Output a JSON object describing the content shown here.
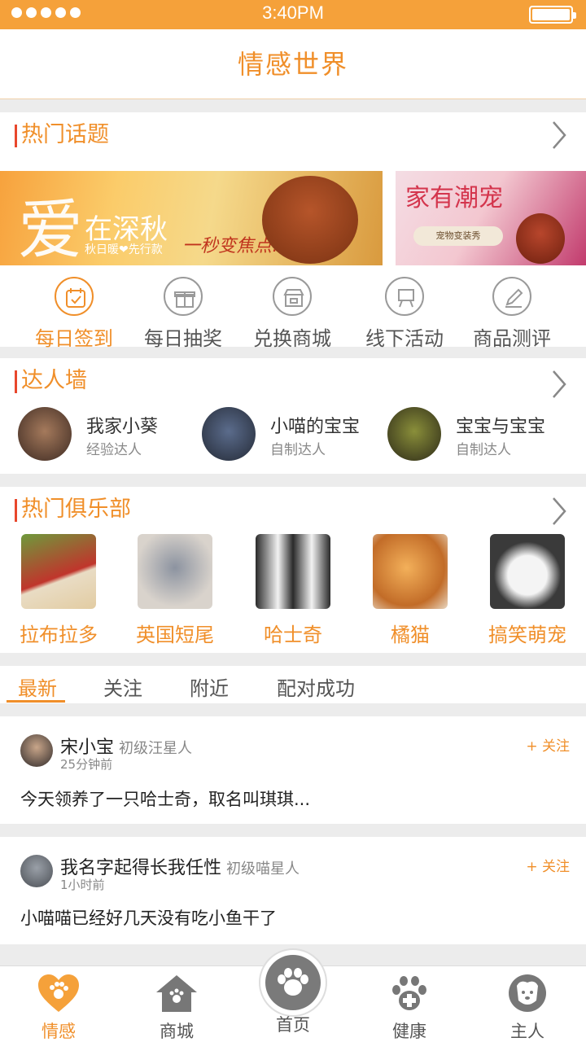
{
  "status_bar": {
    "time": "3:40PM"
  },
  "header": {
    "title": "情感世界"
  },
  "hot_topics": {
    "title": "热门话题",
    "banner1": {
      "big_char": "爱",
      "subtitle": "在深秋",
      "small": "秋日暖❤先行款",
      "slogan": "一秒变焦点!"
    },
    "banner2": {
      "title": "家有潮宠",
      "tag": "宠物变装秀"
    },
    "quick_actions": [
      {
        "label": "每日签到",
        "icon": "calendar-check-icon"
      },
      {
        "label": "每日抽奖",
        "icon": "gift-icon"
      },
      {
        "label": "兑换商城",
        "icon": "store-icon"
      },
      {
        "label": "线下活动",
        "icon": "easel-icon"
      },
      {
        "label": "商品测评",
        "icon": "pencil-icon"
      }
    ]
  },
  "experts": {
    "title": "达人墙",
    "items": [
      {
        "name": "我家小葵",
        "tag": "经验达人"
      },
      {
        "name": "小喵的宝宝",
        "tag": "自制达人"
      },
      {
        "name": "宝宝与宝宝",
        "tag": "自制达人"
      }
    ]
  },
  "clubs": {
    "title": "热门俱乐部",
    "items": [
      {
        "name": "拉布拉多"
      },
      {
        "name": "英国短尾"
      },
      {
        "name": "哈士奇"
      },
      {
        "name": "橘猫"
      },
      {
        "name": "搞笑萌宠"
      }
    ]
  },
  "feed_tabs": [
    "最新",
    "关注",
    "附近",
    "配对成功"
  ],
  "posts": [
    {
      "name": "宋小宝",
      "level": "初级汪星人",
      "ago": "25分钟前",
      "follow": "+ 关注",
      "body": "今天领养了一只哈士奇，取名叫琪琪..."
    },
    {
      "name": "我名字起得长我任性",
      "level": "初级喵星人",
      "ago": "1小时前",
      "follow": "+ 关注",
      "body": "小喵喵已经好几天没有吃小鱼干了"
    }
  ],
  "tabbar": {
    "items": [
      {
        "label": "情感",
        "icon": "heart-paw-icon"
      },
      {
        "label": "商城",
        "icon": "house-icon"
      },
      {
        "label": "首页",
        "icon": "paw-icon"
      },
      {
        "label": "健康",
        "icon": "paw-plus-icon"
      },
      {
        "label": "主人",
        "icon": "dog-face-icon"
      }
    ]
  },
  "colors": {
    "accent": "#f08f2a",
    "status_bar": "#f5a13a",
    "marker": "#e8472c"
  }
}
